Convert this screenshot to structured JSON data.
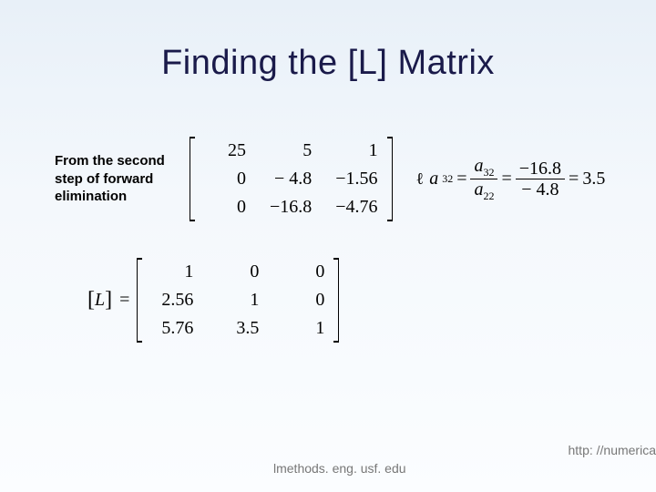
{
  "title": "Finding the [L] Matrix",
  "caption": "From the second step of forward elimination",
  "matrix1": {
    "r1c1": "25",
    "r1c2": "5",
    "r1c3": "1",
    "r2c1": "0",
    "r2c2": "− 4.8",
    "r2c3": "−1.56",
    "r3c1": "0",
    "r3c2": "−16.8",
    "r3c3": "−4.76"
  },
  "equation": {
    "lead_glyph": "ℓ",
    "lhs_var": "a",
    "lhs_sub": "32",
    "eq": "=",
    "num_var": "a",
    "num_sub": "32",
    "den_var": "a",
    "den_sub": "22",
    "val_num": "−16.8",
    "val_den": "− 4.8",
    "result": "3.5"
  },
  "Llabel": {
    "lb": "[",
    "L": "L",
    "rb": "]",
    "eq": "="
  },
  "matrix2": {
    "r1c1": "1",
    "r1c2": "0",
    "r1c3": "0",
    "r2c1": "2.56",
    "r2c2": "1",
    "r2c3": "0",
    "r3c1": "5.76",
    "r3c2": "3.5",
    "r3c3": "1"
  },
  "footer_l": "lmethods. eng. usf. edu",
  "footer_r": "http: //numerica",
  "chart_data": {
    "type": "table",
    "title": "Finding the [L] Matrix — LU decomposition L matrix derivation",
    "intermediate_matrix_after_step2": [
      [
        25,
        5,
        1
      ],
      [
        0,
        -4.8,
        -1.56
      ],
      [
        0,
        -16.8,
        -4.76
      ]
    ],
    "multiplier_a32": {
      "formula": "a32 / a22",
      "numerator": -16.8,
      "denominator": -4.8,
      "value": 3.5
    },
    "L_matrix": [
      [
        1,
        0,
        0
      ],
      [
        2.56,
        1,
        0
      ],
      [
        5.76,
        3.5,
        1
      ]
    ]
  }
}
